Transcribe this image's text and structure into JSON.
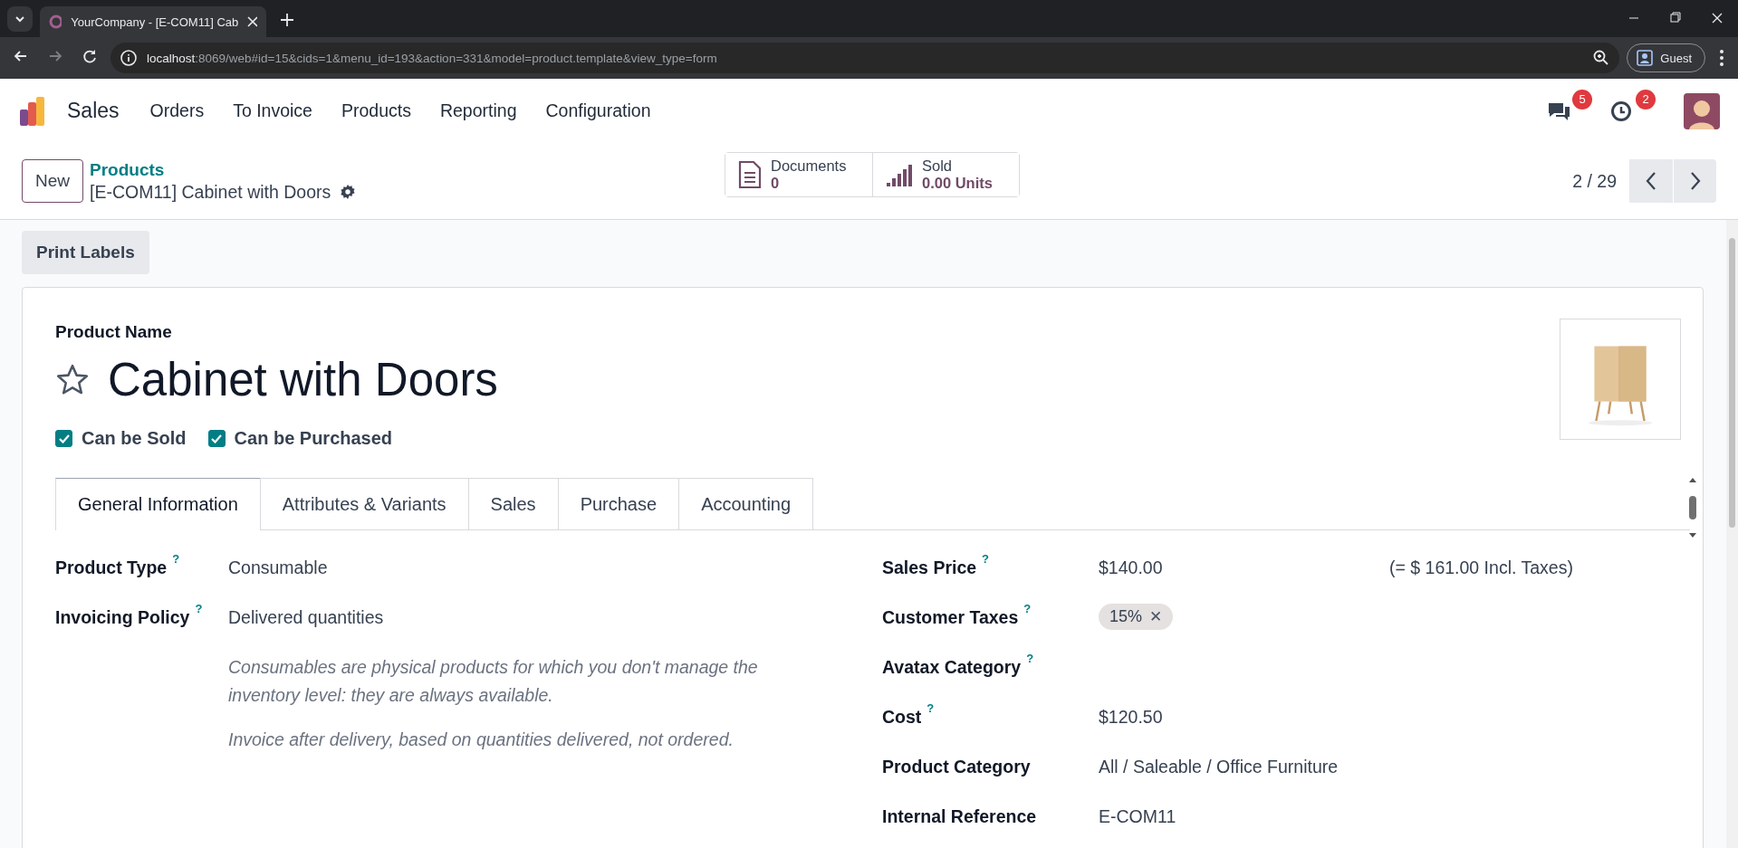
{
  "browser": {
    "tab_title": "YourCompany - [E-COM11] Cab",
    "url_host": "localhost",
    "url_rest": ":8069/web#id=15&cids=1&menu_id=193&action=331&model=product.template&view_type=form",
    "profile": "Guest"
  },
  "navbar": {
    "app": "Sales",
    "menu": [
      "Orders",
      "To Invoice",
      "Products",
      "Reporting",
      "Configuration"
    ],
    "messages_badge": "5",
    "activities_badge": "2"
  },
  "control_panel": {
    "new_button": "New",
    "breadcrumb": "Products",
    "record": "[E-COM11] Cabinet with Doors",
    "smart_buttons": [
      {
        "kind": "documents",
        "label": "Documents",
        "value": "0"
      },
      {
        "kind": "sold",
        "label": "Sold",
        "value": "0.00 Units"
      }
    ],
    "pager": "2 / 29"
  },
  "actions": [
    "Print Labels"
  ],
  "form": {
    "name_label": "Product Name",
    "name": "Cabinet with Doors",
    "favorite": false,
    "options": [
      {
        "label": "Can be Sold",
        "checked": true
      },
      {
        "label": "Can be Purchased",
        "checked": true
      }
    ],
    "tabs": [
      {
        "label": "General Information",
        "selected": true
      },
      {
        "label": "Attributes & Variants",
        "selected": false
      },
      {
        "label": "Sales",
        "selected": false
      },
      {
        "label": "Purchase",
        "selected": false
      },
      {
        "label": "Accounting",
        "selected": false
      }
    ],
    "left_fields": [
      {
        "label": "Product Type",
        "help": "?",
        "value": "Consumable"
      },
      {
        "label": "Invoicing Policy",
        "help": "?",
        "value": "Delivered quantities"
      }
    ],
    "notes": [
      "Consumables are physical products for which you don't manage the inventory level: they are always available.",
      "Invoice after delivery, based on quantities delivered, not ordered."
    ],
    "right_fields": [
      {
        "kind": "text",
        "label": "Sales Price",
        "help": "?",
        "value": "$140.00",
        "extra": "(= $ 161.00 Incl. Taxes)"
      },
      {
        "kind": "tag",
        "label": "Customer Taxes",
        "help": "?",
        "value": "15%",
        "remove": "✕"
      },
      {
        "kind": "text",
        "label": "Avatax Category",
        "help": "?"
      },
      {
        "kind": "text",
        "label": "Cost",
        "help": "?",
        "value": "$120.50"
      },
      {
        "kind": "text",
        "label": "Product Category",
        "value": "All / Saleable / Office Furniture"
      },
      {
        "kind": "text",
        "label": "Internal Reference",
        "value": "E-COM11"
      }
    ]
  }
}
